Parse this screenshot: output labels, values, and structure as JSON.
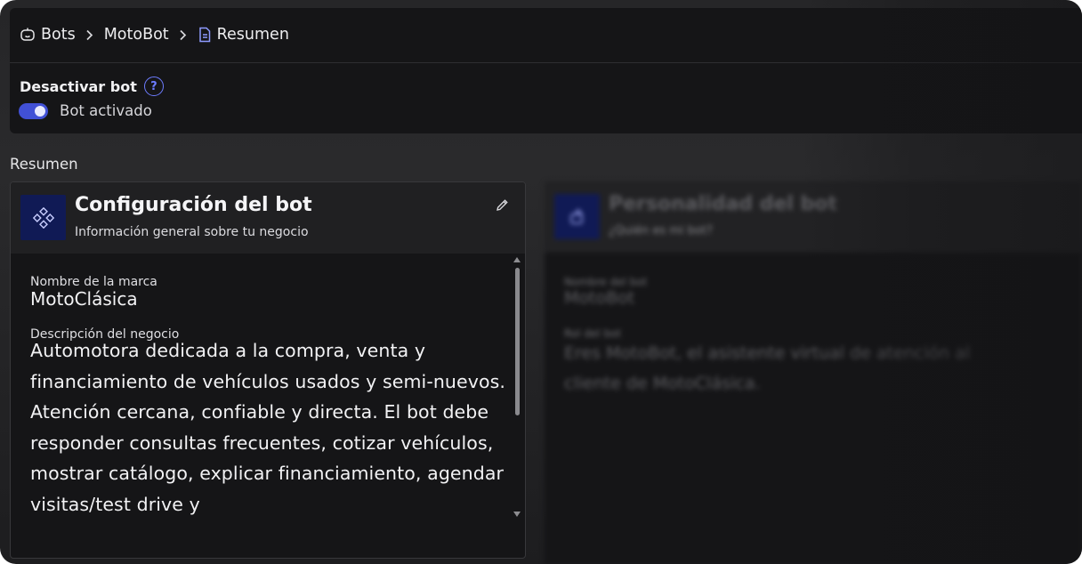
{
  "breadcrumb": {
    "items": [
      {
        "label": "Bots",
        "icon": "bot-face-icon"
      },
      {
        "label": "MotoBot"
      },
      {
        "label": "Resumen",
        "icon": "document-icon"
      }
    ],
    "separator_icon": "chevron-right-icon"
  },
  "bot_status": {
    "heading": "Desactivar bot",
    "help_icon_text": "?",
    "toggle_on": true,
    "toggle_label": "Bot activado"
  },
  "section": {
    "title": "Resumen"
  },
  "config_card": {
    "icon": "diamond-grid-icon",
    "title": "Configuración del bot",
    "subtitle": "Información general sobre tu negocio",
    "edit_icon": "pencil-icon",
    "fields": [
      {
        "label": "Nombre de la marca",
        "value": "MotoClásica"
      },
      {
        "label": "Descripción del negocio",
        "value": "Automotora dedicada a la compra, venta y financiamiento de vehículos usados y semi-nuevos. Atención cercana, confiable y directa. El bot debe responder consultas frecuentes, cotizar vehículos, mostrar catálogo, explicar financiamiento, agendar visitas/test drive y"
      }
    ]
  },
  "personality_card": {
    "icon": "bot-head-icon",
    "title": "Personalidad del bot",
    "subtitle": "¿Quién es mi bot?",
    "fields": [
      {
        "label": "Nombre del bot",
        "value": "MotoBot"
      },
      {
        "label": "Rol del bot",
        "value": "Eres MotoBot, el asistente virtual de atención al cliente de MotoClásica."
      }
    ]
  },
  "colors": {
    "accent": "#4150d6",
    "help_ring": "#6d7cff",
    "icon_box": "#101a55"
  }
}
